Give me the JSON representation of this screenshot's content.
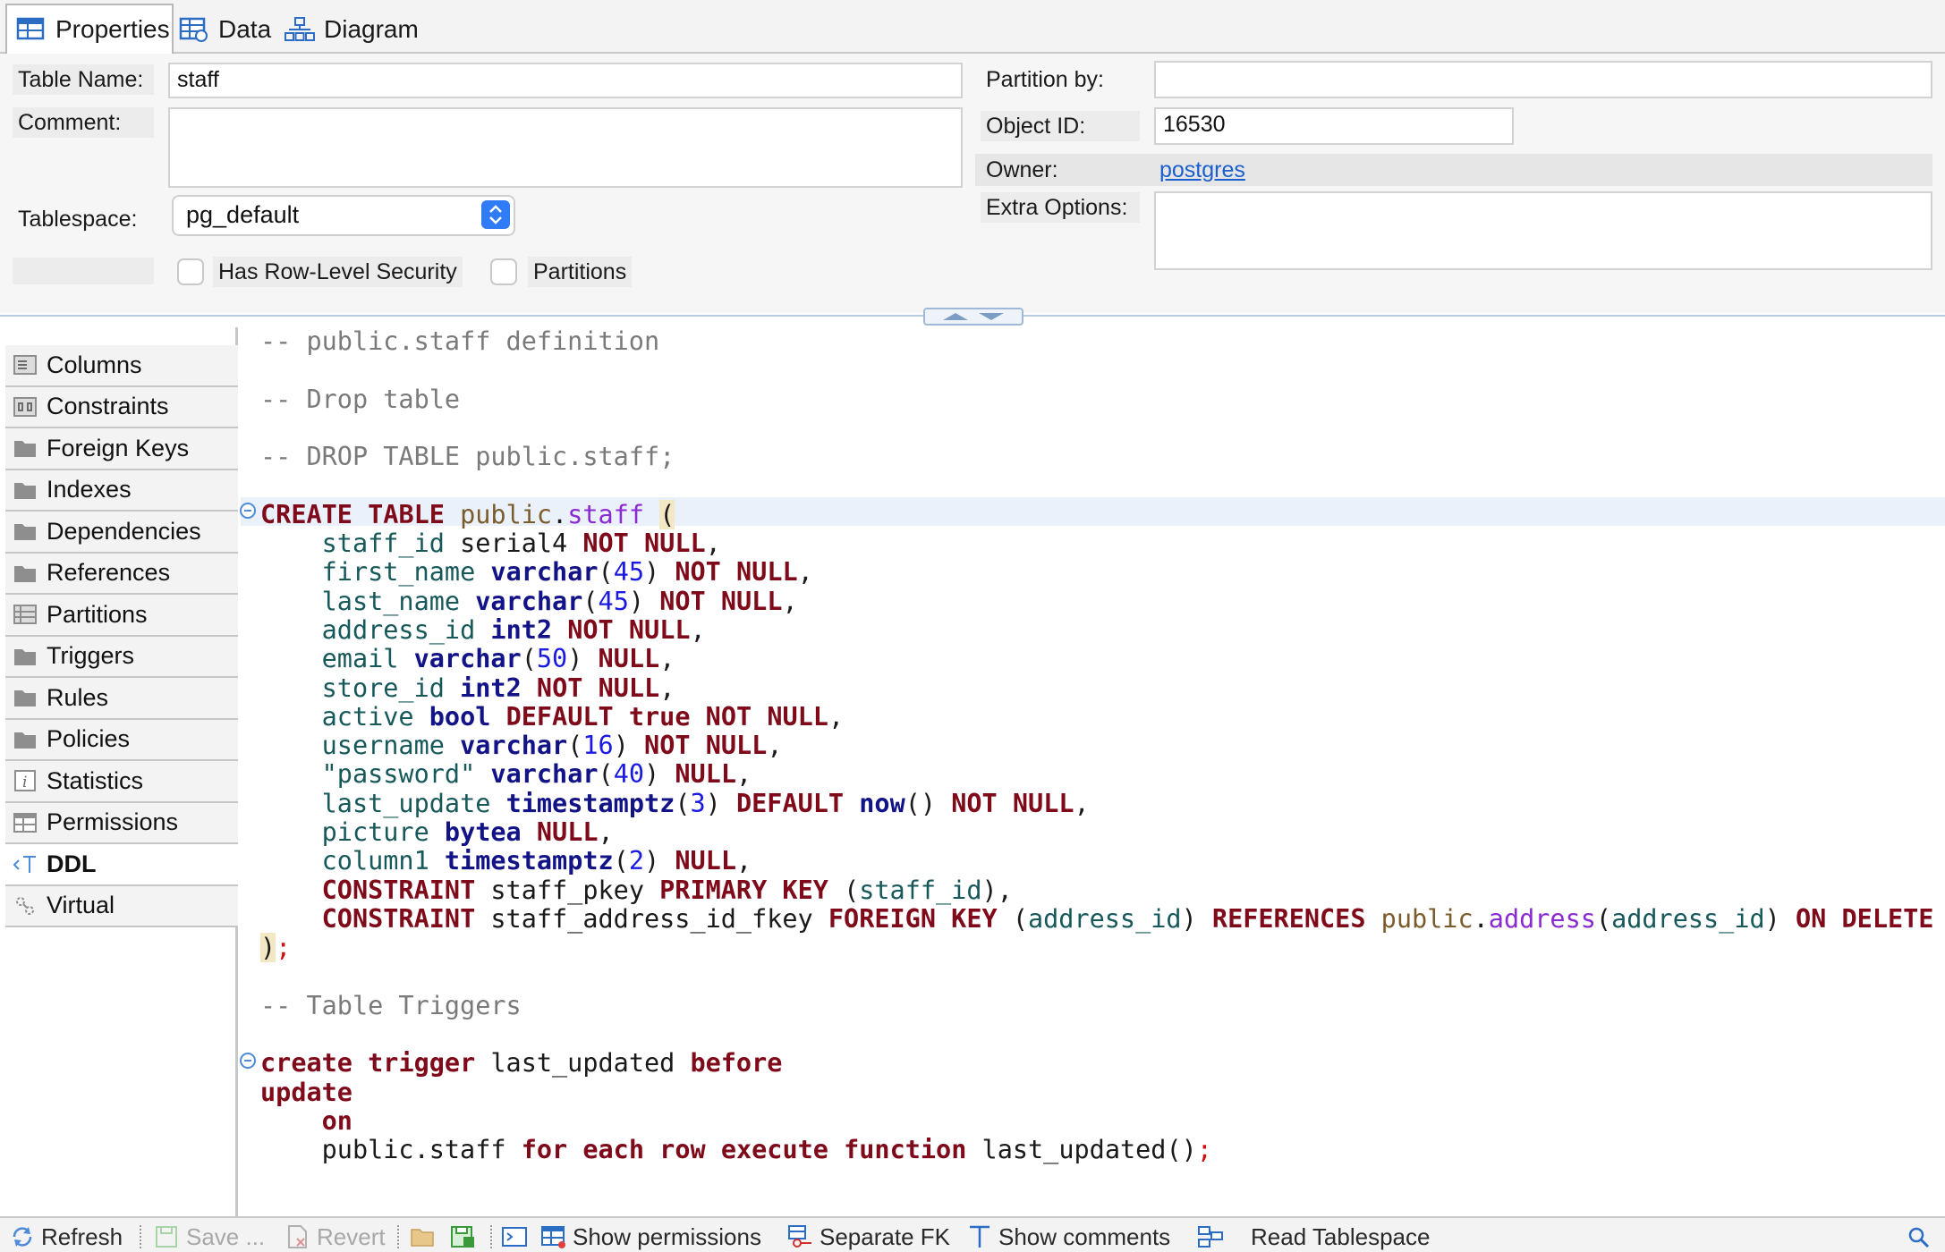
{
  "tabs": [
    {
      "label": "Properties",
      "icon": "table-icon",
      "active": true
    },
    {
      "label": "Data",
      "icon": "data-grid-icon",
      "active": false
    },
    {
      "label": "Diagram",
      "icon": "diagram-icon",
      "active": false
    }
  ],
  "properties": {
    "table_name_label": "Table Name:",
    "table_name_value": "staff",
    "comment_label": "Comment:",
    "comment_value": "",
    "tablespace_label": "Tablespace:",
    "tablespace_value": "pg_default",
    "row_level_security_label": "Has Row-Level Security",
    "row_level_security_checked": false,
    "partitions_label": "Partitions",
    "partitions_checked": false,
    "partition_by_label": "Partition by:",
    "partition_by_value": "",
    "object_id_label": "Object ID:",
    "object_id_value": "16530",
    "owner_label": "Owner:",
    "owner_value": "postgres",
    "extra_options_label": "Extra Options:",
    "extra_options_value": ""
  },
  "nav": {
    "items": [
      {
        "label": "Columns",
        "icon": "columns-icon"
      },
      {
        "label": "Constraints",
        "icon": "constraints-icon"
      },
      {
        "label": "Foreign Keys",
        "icon": "folder-icon"
      },
      {
        "label": "Indexes",
        "icon": "folder-icon"
      },
      {
        "label": "Dependencies",
        "icon": "folder-icon"
      },
      {
        "label": "References",
        "icon": "folder-icon"
      },
      {
        "label": "Partitions",
        "icon": "partitions-icon"
      },
      {
        "label": "Triggers",
        "icon": "folder-icon"
      },
      {
        "label": "Rules",
        "icon": "folder-icon"
      },
      {
        "label": "Policies",
        "icon": "folder-icon"
      },
      {
        "label": "Statistics",
        "icon": "info-icon"
      },
      {
        "label": "Permissions",
        "icon": "permissions-icon"
      },
      {
        "label": "DDL",
        "icon": "ddl-icon",
        "active": true
      },
      {
        "label": "Virtual",
        "icon": "virtual-icon"
      }
    ]
  },
  "ddl": {
    "lines": [
      "-- public.staff definition",
      "",
      "-- Drop table",
      "",
      "-- DROP TABLE public.staff;",
      "",
      "CREATE TABLE public.staff (",
      "    staff_id serial4 NOT NULL,",
      "    first_name varchar(45) NOT NULL,",
      "    last_name varchar(45) NOT NULL,",
      "    address_id int2 NOT NULL,",
      "    email varchar(50) NULL,",
      "    store_id int2 NOT NULL,",
      "    active bool DEFAULT true NOT NULL,",
      "    username varchar(16) NOT NULL,",
      "    \"password\" varchar(40) NULL,",
      "    last_update timestamptz(3) DEFAULT now() NOT NULL,",
      "    picture bytea NULL,",
      "    column1 timestamptz(2) NULL,",
      "    CONSTRAINT staff_pkey PRIMARY KEY (staff_id),",
      "    CONSTRAINT staff_address_id_fkey FOREIGN KEY (address_id) REFERENCES public.address(address_id) ON DELETE R",
      ");",
      "",
      "-- Table Triggers",
      "",
      "create trigger last_updated before",
      "update",
      "    on",
      "    public.staff for each row execute function last_updated();"
    ]
  },
  "toolbar": {
    "refresh": "Refresh",
    "save": "Save ...",
    "revert": "Revert",
    "show_permissions": "Show permissions",
    "separate_fk": "Separate FK",
    "show_comments": "Show comments",
    "read_tablespace": "Read Tablespace"
  },
  "colors": {
    "keyword": "#7f0a1a",
    "type": "#131388",
    "comment": "#7a7a7a",
    "column": "#17585a",
    "number": "#1a1ae0",
    "link": "#1a5fd0"
  }
}
